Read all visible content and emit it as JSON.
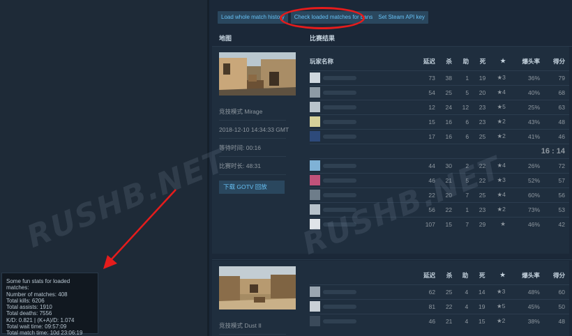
{
  "toolbar": {
    "btn_history": "Load whole match history",
    "btn_bans": "Check loaded matches for bans",
    "btn_api": "Set Steam API key"
  },
  "headers": {
    "map": "地图",
    "result": "比赛结果"
  },
  "columns": {
    "player": "玩家名称",
    "ping": "延迟",
    "kills": "杀",
    "assists": "助",
    "deaths": "死",
    "star": "★",
    "hs": "爆头率",
    "score": "得分"
  },
  "match1": {
    "mode_map": "竞技模式 Mirage",
    "date": "2018-12-10 14:34:33 GMT",
    "wait": "等待时间: 00:16",
    "duration": "比赛时长: 48:31",
    "gotv": "下载 GOTV 回放",
    "score_line": "16 : 14",
    "team1": [
      {
        "ping": "73",
        "k": "38",
        "a": "1",
        "d": "19",
        "star": "★3",
        "hs": "36%",
        "score": "79"
      },
      {
        "ping": "54",
        "k": "25",
        "a": "5",
        "d": "20",
        "star": "★4",
        "hs": "40%",
        "score": "68"
      },
      {
        "ping": "12",
        "k": "24",
        "a": "12",
        "d": "23",
        "star": "★5",
        "hs": "25%",
        "score": "63"
      },
      {
        "ping": "15",
        "k": "16",
        "a": "6",
        "d": "23",
        "star": "★2",
        "hs": "43%",
        "score": "48"
      },
      {
        "ping": "17",
        "k": "16",
        "a": "6",
        "d": "25",
        "star": "★2",
        "hs": "41%",
        "score": "46"
      }
    ],
    "team2": [
      {
        "ping": "44",
        "k": "30",
        "a": "2",
        "d": "22",
        "star": "★4",
        "hs": "26%",
        "score": "72"
      },
      {
        "ping": "46",
        "k": "21",
        "a": "5",
        "d": "22",
        "star": "★3",
        "hs": "52%",
        "score": "57"
      },
      {
        "ping": "22",
        "k": "20",
        "a": "7",
        "d": "25",
        "star": "★4",
        "hs": "60%",
        "score": "56"
      },
      {
        "ping": "56",
        "k": "22",
        "a": "1",
        "d": "23",
        "star": "★2",
        "hs": "73%",
        "score": "53"
      },
      {
        "ping": "107",
        "k": "15",
        "a": "7",
        "d": "29",
        "star": "★",
        "hs": "46%",
        "score": "42"
      }
    ]
  },
  "match2": {
    "mode_map": "竞技模式 Dust II",
    "team1": [
      {
        "ping": "62",
        "k": "25",
        "a": "4",
        "d": "14",
        "star": "★3",
        "hs": "48%",
        "score": "60"
      },
      {
        "ping": "81",
        "k": "22",
        "a": "4",
        "d": "19",
        "star": "★5",
        "hs": "45%",
        "score": "50"
      },
      {
        "ping": "46",
        "k": "21",
        "a": "4",
        "d": "15",
        "star": "★2",
        "hs": "38%",
        "score": "48"
      }
    ]
  },
  "stats": {
    "line1": "Some fun stats for loaded matches:",
    "line2": "Number of matches: 408",
    "line3": "Total kills: 6206",
    "line4": "Total assists: 1910",
    "line5": "Total deaths: 7556",
    "line6": "K/D: 0.821 | (K+A)/D: 1.074",
    "line7": "Total wait time: 09:57:09",
    "line8": "Total match time: 10d 23:06:19"
  },
  "watermark": "RUSHB.NET",
  "colors": {
    "highlight": "#e51c1c",
    "button_bg": "#2a475e",
    "button_text": "#66c0f4",
    "page_bg": "#1b2838"
  },
  "avatar_colors": [
    "#cfd7de",
    "#8d9aa5",
    "#b9c4cc",
    "#d6d19a",
    "#2d4a7a",
    "#7fb2d6",
    "#c0527a",
    "#6e7d8a",
    "#b7c2cb",
    "#e0e4e8",
    "#9aa6b1",
    "#c9d0d6",
    "#3b4a5a"
  ]
}
